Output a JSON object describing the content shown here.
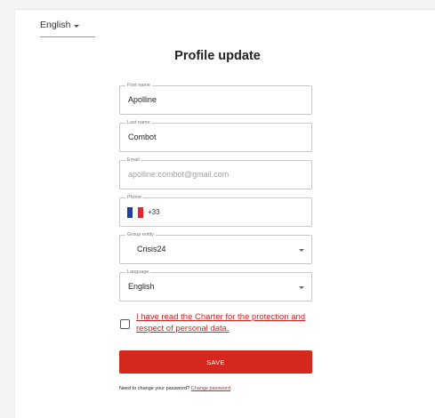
{
  "language_switch": {
    "label": "English"
  },
  "page": {
    "title": "Profile update"
  },
  "form": {
    "first_name": {
      "label": "First name",
      "value": "Apolline"
    },
    "last_name": {
      "label": "Last name",
      "value": "Combot"
    },
    "email": {
      "label": "Email",
      "value": "apolline.combot@gmail.com"
    },
    "phone": {
      "label": "Phone",
      "country_code": "+33",
      "flag_colors": [
        "#1f3f9a",
        "#ffffff",
        "#e4262c"
      ]
    },
    "group_entity": {
      "label": "Group entity",
      "value": "Crisis24"
    },
    "language": {
      "label": "Language",
      "value": "English"
    },
    "consent": {
      "text": "I have read the Charter for the protection and respect of personal data."
    },
    "save_label": "SAVE"
  },
  "password": {
    "prompt": "Need to change your password?",
    "link": "Change password"
  },
  "colors": {
    "accent": "#d6271f",
    "link": "#d32424"
  }
}
